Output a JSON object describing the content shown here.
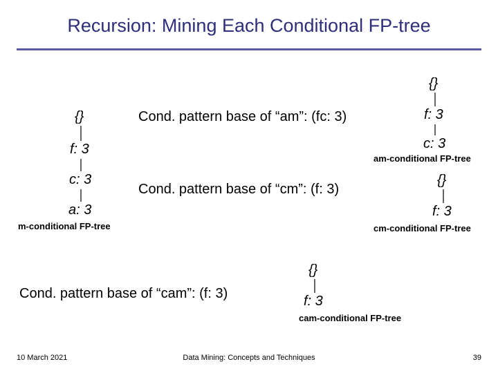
{
  "title": "Recursion: Mining Each Conditional FP-tree",
  "footer": {
    "date": "10 March 2021",
    "center": "Data Mining: Concepts and Techniques",
    "page": "39"
  },
  "pattern": {
    "am": "Cond. pattern base of “am”: (fc: 3)",
    "cm": "Cond. pattern base of “cm”: (f: 3)",
    "cam": "Cond. pattern base of “cam”: (f: 3)"
  },
  "captions": {
    "m": "m-conditional FP-tree",
    "am": "am-conditional FP-tree",
    "cm": "cm-conditional FP-tree",
    "cam": "cam-conditional FP-tree"
  },
  "trees": {
    "m": {
      "root": "{}",
      "n1": "f: 3",
      "n2": "c: 3",
      "n3": "a: 3"
    },
    "am": {
      "root": "{}",
      "n1": "f: 3",
      "n2": "c: 3"
    },
    "cm": {
      "root": "{}",
      "n1": "f: 3"
    },
    "cam": {
      "root": "{}",
      "n1": "f: 3"
    }
  }
}
